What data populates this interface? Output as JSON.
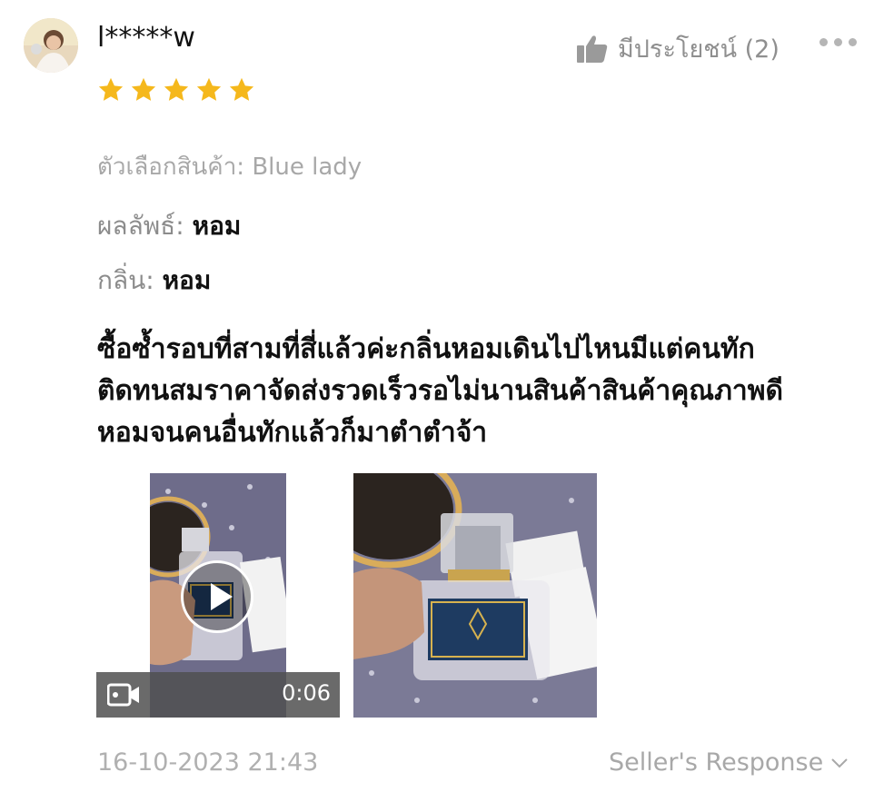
{
  "review": {
    "username": "l*****w",
    "rating": 5,
    "helpful_label": "มีประโยชน์ (2)",
    "variant_label": "ตัวเลือกสินค้า: Blue lady",
    "attributes": [
      {
        "key": "ผลลัพธ์:",
        "value": "หอม"
      },
      {
        "key": "กลิ่น:",
        "value": "หอม"
      }
    ],
    "text_lines": [
      "ซื้อซ้ำรอบที่สามที่สี่แล้วค่ะกลิ่นหอมเดินไปไหนมีแต่คนทัก",
      "ติดทนสมราคาจัดส่งรวดเร็วรอไม่นานสินค้าสินค้าคุณภาพดี",
      "หอมจนคนอื่นทักแล้วก็มาตำตำจ้า"
    ],
    "video_duration": "0:06",
    "date": "16-10-2023 21:43",
    "seller_response_label": "Seller's Response"
  },
  "colors": {
    "star": "#f5b81c",
    "muted_text": "#a8a8a8",
    "dark_text": "#111111"
  },
  "icons": [
    "thumbs-up-icon",
    "more-dots-icon",
    "video-camera-icon",
    "play-icon",
    "chevron-down-icon",
    "star-icon"
  ]
}
